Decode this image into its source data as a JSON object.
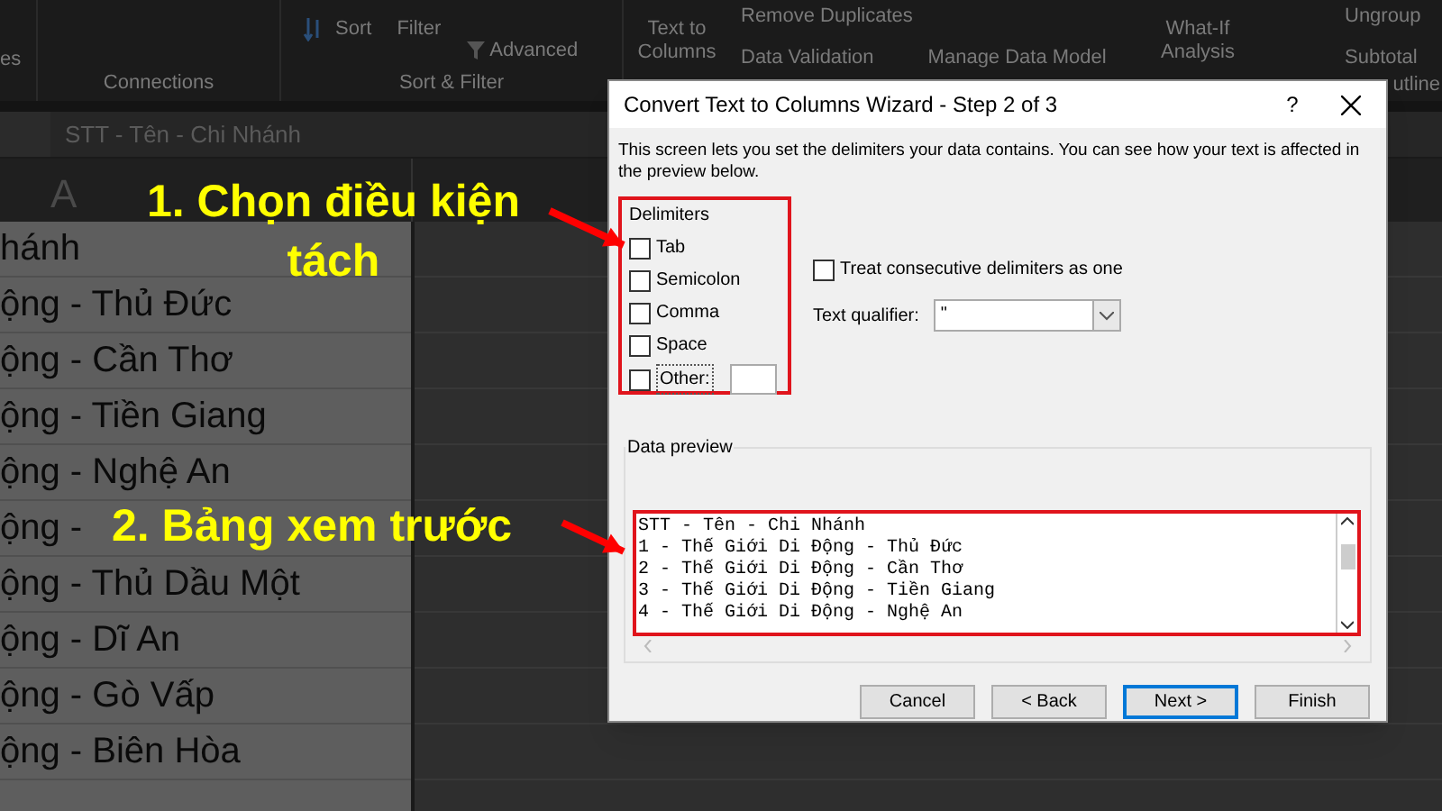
{
  "ribbon": {
    "left_cut": "es",
    "groups": [
      {
        "label": "Connections"
      },
      {
        "label": "Sort & Filter"
      }
    ],
    "sort": "Sort",
    "filter": "Filter",
    "advanced": "Advanced",
    "text_to_columns": [
      "Text to",
      "Columns"
    ],
    "remove_duplicates": "Remove Duplicates",
    "data_validation": "Data Validation",
    "manage_data_model": "Manage Data Model",
    "what_if": [
      "What-If",
      "Analysis"
    ],
    "ungroup": "Ungroup",
    "subtotal": "Subtotal",
    "outline": "utline"
  },
  "formula_bar": {
    "value": "STT - Tên - Chi Nhánh"
  },
  "sheet": {
    "column_header": "A",
    "cells": [
      "hánh",
      "ộng - Thủ Đức",
      "ộng - Cần Thơ",
      "ộng - Tiền Giang",
      "ộng - Nghệ An",
      "ộng -",
      "ộng - Thủ Dầu Một",
      "ộng - Dĩ An",
      "ộng - Gò Vấp",
      "ộng - Biên Hòa"
    ]
  },
  "dialog": {
    "title": "Convert Text to Columns Wizard - Step 2 of 3",
    "help": "?",
    "description": "This screen lets you set the delimiters your data contains.  You can see how your text is affected in the preview below.",
    "delimiters": {
      "title": "Delimiters",
      "items": [
        {
          "label": "Tab",
          "checked": false
        },
        {
          "label": "Semicolon",
          "checked": false
        },
        {
          "label": "Comma",
          "checked": false
        },
        {
          "label": "Space",
          "checked": false
        },
        {
          "label": "Other:",
          "checked": false,
          "kind": "other"
        }
      ]
    },
    "treat_consecutive": {
      "label": "Treat consecutive delimiters as one",
      "checked": false
    },
    "text_qualifier": {
      "label": "Text qualifier:",
      "value": "\""
    },
    "data_preview": {
      "title": "Data preview",
      "lines": [
        "STT - Tên - Chi Nhánh",
        "1 - Thế Giới Di Động - Thủ Đức",
        "2 - Thế Giới Di Động - Cần Thơ",
        "3 - Thế Giới Di Động - Tiền Giang",
        "4 - Thế Giới Di Động - Nghệ An"
      ]
    },
    "buttons": [
      {
        "label": "Cancel",
        "default": false
      },
      {
        "label": "< Back",
        "default": false
      },
      {
        "label": "Next >",
        "default": true
      },
      {
        "label": "Finish",
        "default": false
      }
    ]
  },
  "annotations": [
    {
      "lines": [
        "1. Chọn điều kiện",
        "tách"
      ]
    },
    {
      "lines": [
        "2. Bảng xem trước"
      ]
    }
  ]
}
